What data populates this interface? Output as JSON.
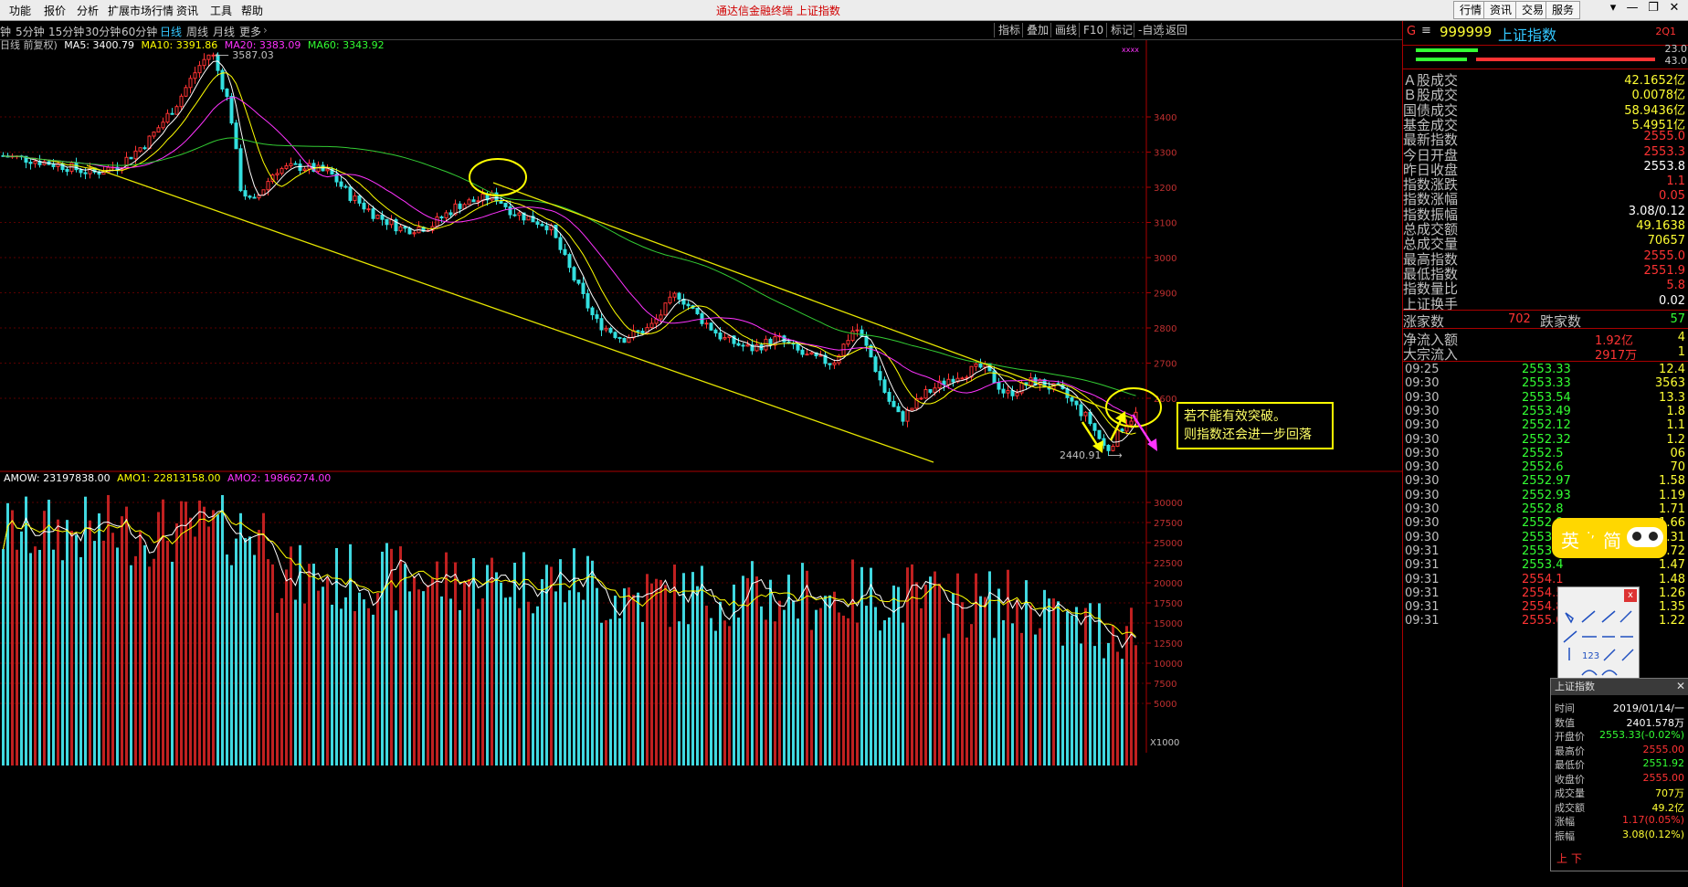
{
  "menubar": {
    "items": [
      "功能",
      "报价",
      "分析",
      "扩展市场行情",
      "资讯",
      "工具",
      "帮助"
    ],
    "center_title": "通达信金融终端  上证指数",
    "right_buttons": [
      "行情",
      "资讯",
      "交易",
      "服务"
    ]
  },
  "periodbar": {
    "periods": [
      "钟",
      "5分钟",
      "15分钟",
      "30分钟",
      "60分钟",
      "日线",
      "周线",
      "月线",
      "更多"
    ],
    "active": "日线",
    "tools": [
      "指标",
      "叠加",
      "画线",
      "F10",
      "标记",
      "-自选",
      "返回"
    ]
  },
  "kline": {
    "legend": {
      "label": "日线 前复权)",
      "ma5": "MA5: 3400.79",
      "ma10": "MA10: 3391.86",
      "ma20": "MA20: 3383.09",
      "ma60": "MA60: 3343.92"
    },
    "high_label": "3587.03",
    "low_label": "2440.91",
    "y_ticks": [
      "3400",
      "3300",
      "3200",
      "3100",
      "3000",
      "2900",
      "2800",
      "2700",
      "2600"
    ],
    "corner_mark": "xxxx",
    "annotation": [
      "若不能有效突破。",
      "则指数还会进一步回落"
    ]
  },
  "volume": {
    "legend": {
      "amow": "AMOW: 23197838.00",
      "amo1": "AMO1: 22813158.00",
      "amo2": "AMO2: 19866274.00"
    },
    "y_ticks": [
      "30000",
      "27500",
      "25000",
      "22500",
      "20000",
      "17500",
      "15000",
      "12500",
      "10000",
      "7500",
      "5000"
    ],
    "unit": "X1000"
  },
  "right_panel": {
    "code": "999999",
    "name": "上证指数",
    "suffix": "2Q1",
    "bar_vals": [
      "23.0",
      "43.0"
    ],
    "stats": [
      {
        "k": "Ａ股成交",
        "v": "42.1652亿",
        "c": "#ffff33"
      },
      {
        "k": "Ｂ股成交",
        "v": "0.0078亿",
        "c": "#ffff33"
      },
      {
        "k": "国债成交",
        "v": "58.9436亿",
        "c": "#ffff33"
      },
      {
        "k": "基金成交",
        "v": "5.4951亿",
        "c": "#ffff33"
      },
      {
        "k": "最新指数",
        "v": "2555.0",
        "c": "#ff3333"
      },
      {
        "k": "今日开盘",
        "v": "2553.3",
        "c": "#ff3333"
      },
      {
        "k": "昨日收盘",
        "v": "2553.8",
        "c": "#ffffff"
      },
      {
        "k": "指数涨跌",
        "v": "1.1",
        "c": "#ff3333"
      },
      {
        "k": "指数涨幅",
        "v": "0.05",
        "c": "#ff3333"
      },
      {
        "k": "指数振幅",
        "v": "3.08/0.12",
        "c": "#ffffff"
      },
      {
        "k": "总成交额",
        "v": "49.1638",
        "c": "#ffff33"
      },
      {
        "k": "总成交量",
        "v": "70657",
        "c": "#ffff33"
      },
      {
        "k": "最高指数",
        "v": "2555.0",
        "c": "#ff3333"
      },
      {
        "k": "最低指数",
        "v": "2551.9",
        "c": "#ff3333"
      },
      {
        "k": "指数量比",
        "v": "5.8",
        "c": "#ff3333"
      },
      {
        "k": "上证换手",
        "v": "0.02",
        "c": "#ffffff"
      }
    ],
    "updown": {
      "up_label": "涨家数",
      "up": "702",
      "down_label": "跌家数",
      "down": "57"
    },
    "flow": [
      {
        "k": "净流入额",
        "v": "1.92亿",
        "v2": "4"
      },
      {
        "k": "大宗流入",
        "v": "2917万",
        "v2": "1"
      }
    ],
    "ticks": [
      {
        "t": "09:25",
        "p": "2553.33",
        "q": "12.4"
      },
      {
        "t": "09:30",
        "p": "2553.33",
        "q": "3563"
      },
      {
        "t": "09:30",
        "p": "2553.54",
        "q": "13.3"
      },
      {
        "t": "09:30",
        "p": "2553.49",
        "q": "1.8"
      },
      {
        "t": "09:30",
        "p": "2552.12",
        "q": "1.1"
      },
      {
        "t": "09:30",
        "p": "2552.32",
        "q": "1.2"
      },
      {
        "t": "09:30",
        "p": "2552.5",
        "q": "06"
      },
      {
        "t": "09:30",
        "p": "2552.6",
        "q": "70"
      },
      {
        "t": "09:30",
        "p": "2552.97",
        "q": "1.58"
      },
      {
        "t": "09:30",
        "p": "2552.93",
        "q": "1.19"
      },
      {
        "t": "09:30",
        "p": "2552.8",
        "q": "1.71"
      },
      {
        "t": "09:30",
        "p": "2552.9",
        "q": "1.66"
      },
      {
        "t": "09:30",
        "p": "2553.1",
        "q": "1.31"
      },
      {
        "t": "09:31",
        "p": "2553.2",
        "q": "1.72"
      },
      {
        "t": "09:31",
        "p": "2553.4",
        "q": "1.47"
      },
      {
        "t": "09:31",
        "p": "2554.1",
        "q": "1.48"
      },
      {
        "t": "09:31",
        "p": "2554.5",
        "q": "1.26"
      },
      {
        "t": "09:31",
        "p": "2554.8",
        "q": "1.35"
      },
      {
        "t": "09:31",
        "p": "2555.0",
        "q": "1.22"
      }
    ]
  },
  "ime": {
    "chars": [
      "英",
      "简"
    ],
    "mid": "·,"
  },
  "hint": {
    "title": "上证指数",
    "rows": [
      {
        "k": "时间",
        "v": "2019/01/14/一",
        "c": "#ffffff"
      },
      {
        "k": "数值",
        "v": "2401.578万",
        "c": "#ffffff"
      },
      {
        "k": "开盘价",
        "v": "2553.33(-0.02%)",
        "c": "#33ff33"
      },
      {
        "k": "最高价",
        "v": "2555.00",
        "c": "#ff3333"
      },
      {
        "k": "最低价",
        "v": "2551.92",
        "c": "#33ff33"
      },
      {
        "k": "收盘价",
        "v": "2555.00",
        "c": "#ff3333"
      },
      {
        "k": "成交量",
        "v": "707万",
        "c": "#ffff33"
      },
      {
        "k": "成交额",
        "v": "49.2亿",
        "c": "#ffff33"
      },
      {
        "k": "涨幅",
        "v": "1.17(0.05%)",
        "c": "#ff3333"
      },
      {
        "k": "振幅",
        "v": "3.08(0.12%)",
        "c": "#ffff33"
      }
    ],
    "footer": [
      "上",
      "下"
    ]
  }
}
